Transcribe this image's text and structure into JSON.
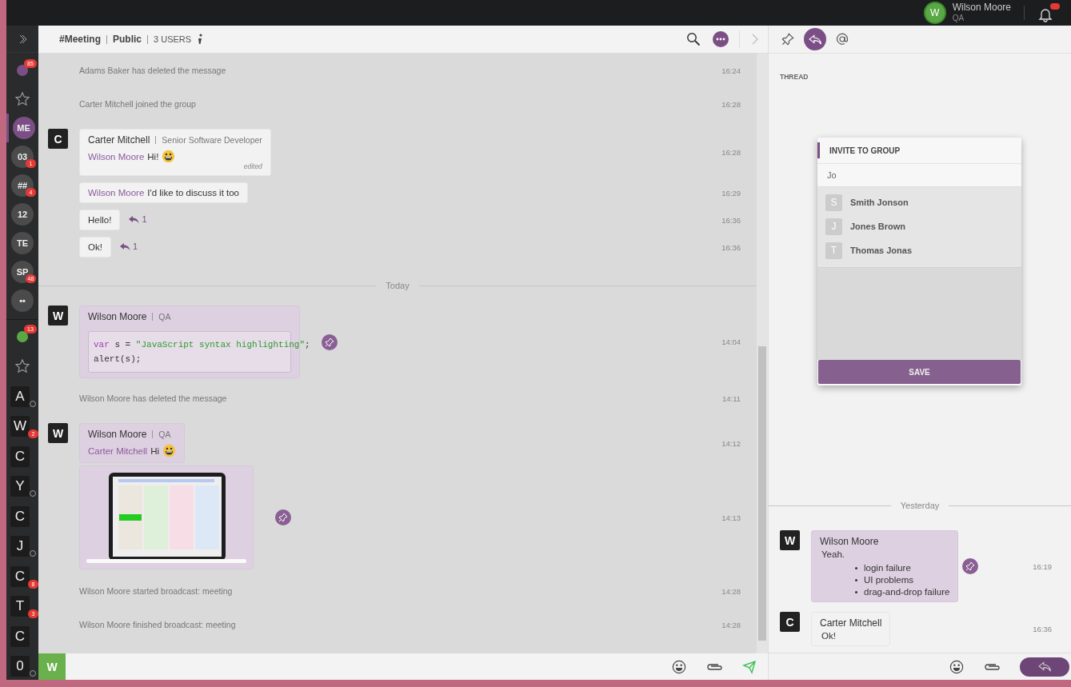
{
  "top_bar": {
    "user": {
      "avatar": "W",
      "name": "Wilson Moore",
      "role": "QA"
    },
    "notifications": {
      "badge": true
    }
  },
  "sidebar": {
    "channels": [
      {
        "kind": "avatar",
        "color": "#7b4f86",
        "badge": "85",
        "selected": false
      },
      {
        "kind": "favorites",
        "selected": false
      },
      {
        "kind": "circle",
        "label": "ME",
        "selected": true
      },
      {
        "kind": "circle",
        "label": "03",
        "badge": "1",
        "selected": false
      },
      {
        "kind": "circle",
        "label": "##",
        "badge": "4",
        "selected": false
      },
      {
        "kind": "circle",
        "label": "12",
        "selected": false
      },
      {
        "kind": "circle",
        "label": "TE",
        "selected": false
      },
      {
        "kind": "circle",
        "label": "SP",
        "badge": "48",
        "selected": false
      },
      {
        "kind": "circle",
        "label": "••",
        "selected": false
      }
    ],
    "contacts": [
      {
        "kind": "avatar",
        "color": "#5aa845",
        "badge": "13",
        "selected": false
      },
      {
        "kind": "favorites",
        "selected": false
      },
      {
        "kind": "square",
        "label": "A",
        "offline": true,
        "selected": false
      },
      {
        "kind": "square",
        "label": "W",
        "badge": "2",
        "offline": false,
        "selected": false
      },
      {
        "kind": "square",
        "label": "C",
        "offline": false,
        "selected": false
      },
      {
        "kind": "square",
        "label": "Y",
        "offline": true,
        "selected": false
      },
      {
        "kind": "square",
        "label": "C",
        "offline": false,
        "selected": false
      },
      {
        "kind": "square",
        "label": "J",
        "offline": true,
        "selected": false
      },
      {
        "kind": "square",
        "label": "C",
        "badge": "8",
        "offline": false,
        "selected": false
      },
      {
        "kind": "square",
        "label": "T",
        "badge": "3",
        "offline": false,
        "selected": false
      },
      {
        "kind": "square",
        "label": "C",
        "offline": false,
        "selected": false
      },
      {
        "kind": "square",
        "label": "0",
        "offline": true,
        "selected": false
      }
    ]
  },
  "header": {
    "channel": "#Meeting",
    "visibility": "Public",
    "users": "3 USERS"
  },
  "messages": [
    {
      "kind": "system",
      "text": "Adams Baker has deleted the message",
      "time": "16:24"
    },
    {
      "kind": "system",
      "text": "Carter Mitchell joined the group",
      "time": "16:28"
    },
    {
      "kind": "message",
      "avatar": "C",
      "author": "Carter Mitchell",
      "role": "Senior Software Developer",
      "mention": "Wilson Moore",
      "text": "Hi!",
      "emoji": true,
      "edited": "edited",
      "mine": false,
      "time": "16:28"
    },
    {
      "kind": "bubble",
      "mention": "Wilson Moore",
      "text": "I'd like to discuss it too",
      "mine": false,
      "time": "16:29"
    },
    {
      "kind": "bubble",
      "text": "Hello!",
      "replies": "1",
      "mine": false,
      "time": "16:36"
    },
    {
      "kind": "bubble",
      "text": "Ok!",
      "replies": "1",
      "mine": false,
      "time": "16:36"
    },
    {
      "kind": "divider",
      "text": "Today"
    },
    {
      "kind": "code",
      "avatar": "W",
      "author": "Wilson Moore",
      "role": "QA",
      "mine": true,
      "pinned": true,
      "time": "14:04",
      "code": [
        [
          {
            "kind": "keyword",
            "text": "var"
          },
          {
            "kind": "plain",
            "text": " s = "
          },
          {
            "kind": "string",
            "text": "\"JavaScript syntax highlighting\""
          },
          {
            "kind": "plain",
            "text": ";"
          }
        ],
        [
          {
            "kind": "plain",
            "text": "alert(s);"
          }
        ]
      ]
    },
    {
      "kind": "system",
      "text": "Wilson Moore has deleted the message",
      "time": "14:11"
    },
    {
      "kind": "message",
      "avatar": "W",
      "author": "Wilson Moore",
      "role": "QA",
      "mention": "Carter Mitchell",
      "text": "Hi",
      "emoji": true,
      "mine": true,
      "time": "14:12"
    },
    {
      "kind": "image",
      "mine": true,
      "pinned": true,
      "time": "14:13"
    },
    {
      "kind": "system",
      "text": "Wilson Moore started broadcast: meeting",
      "time": "14:28"
    },
    {
      "kind": "system",
      "text": "Wilson Moore finished broadcast: meeting",
      "time": "14:28"
    }
  ],
  "composer": {
    "avatar": "W"
  },
  "thread": {
    "tabs": [
      {
        "kind": "pin",
        "selected": false
      },
      {
        "kind": "reply",
        "selected": true
      },
      {
        "kind": "mention",
        "selected": false
      }
    ],
    "label": "THREAD",
    "divider": "Yesterday",
    "messages": [
      {
        "avatar": "W",
        "author": "Wilson Moore",
        "mine": true,
        "pinned": true,
        "text": "Yeah.",
        "items": [
          "login failure",
          "UI problems",
          "drag-and-drop failure"
        ],
        "time": "16:19"
      },
      {
        "avatar": "C",
        "author": "Carter Mitchell",
        "mine": false,
        "pinned": false,
        "text": "Ok!",
        "time": "16:36"
      }
    ]
  },
  "invite_dialog": {
    "title": "INVITE TO GROUP",
    "query": "Jo",
    "results": [
      {
        "initial": "S",
        "name": "Smith Jonson"
      },
      {
        "initial": "J",
        "name": "Jones Brown"
      },
      {
        "initial": "T",
        "name": "Thomas Jonas"
      }
    ],
    "button": "SAVE"
  }
}
